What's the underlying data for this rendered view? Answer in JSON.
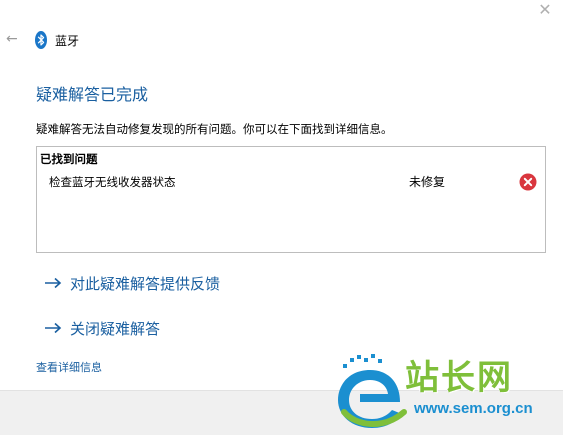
{
  "window": {
    "close_glyph": "✕",
    "back_glyph": "←"
  },
  "header": {
    "title": "蓝牙",
    "icon": "bluetooth-icon",
    "icon_color": "#1a76c8"
  },
  "main": {
    "title": "疑难解答已完成",
    "description": "疑难解答无法自动修复发现的所有问题。你可以在下面找到详细信息。",
    "problems": {
      "header": "已找到问题",
      "items": [
        {
          "name": "检查蓝牙无线收发器状态",
          "status": "未修复",
          "status_icon": "error-icon"
        }
      ]
    },
    "links": {
      "feedback": "对此疑难解答提供反馈",
      "close": "关闭疑难解答",
      "details": "查看详细信息"
    }
  },
  "colors": {
    "accent": "#1a5fa0",
    "error": "#d9363e"
  },
  "watermark": {
    "text": "站长网",
    "url": "www.sem.org.cn"
  }
}
